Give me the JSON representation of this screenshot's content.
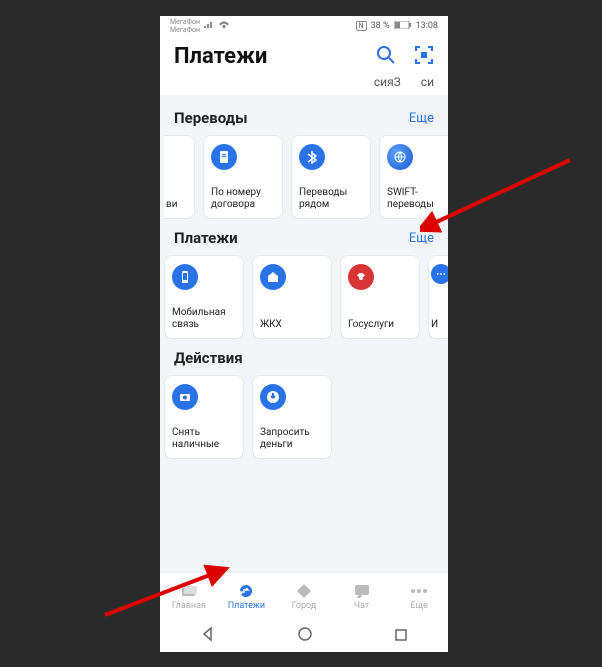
{
  "status_bar": {
    "carrier1": "МегаФон",
    "carrier2": "МегаФон",
    "nfc": "N",
    "battery_pct": "38 %",
    "time": "13:08"
  },
  "header": {
    "title": "Платежи"
  },
  "chips": {
    "a": "сияЗ",
    "b": "си"
  },
  "sections": {
    "transfers": {
      "title": "Переводы",
      "more": "Еще",
      "cards": {
        "left_sliver": "ви",
        "c0": {
          "label": "По номеру договора"
        },
        "c1": {
          "label": "Переводы рядом"
        },
        "c2": {
          "label": "SWIFT-переводы"
        }
      }
    },
    "payments": {
      "title": "Платежи",
      "more": "Еще",
      "cards": {
        "c0": {
          "label": "Мобильная связь"
        },
        "c1": {
          "label": "ЖКХ"
        },
        "c2": {
          "label": "Госуслуги"
        },
        "right_sliver": "И"
      }
    },
    "actions": {
      "title": "Действия",
      "cards": {
        "c0": {
          "label": "Снять наличные"
        },
        "c1": {
          "label": "Запросить деньги"
        }
      }
    }
  },
  "nav": {
    "items": [
      "Главная",
      "Платежи",
      "Город",
      "Чат",
      "Еще"
    ],
    "active_index": 1
  }
}
